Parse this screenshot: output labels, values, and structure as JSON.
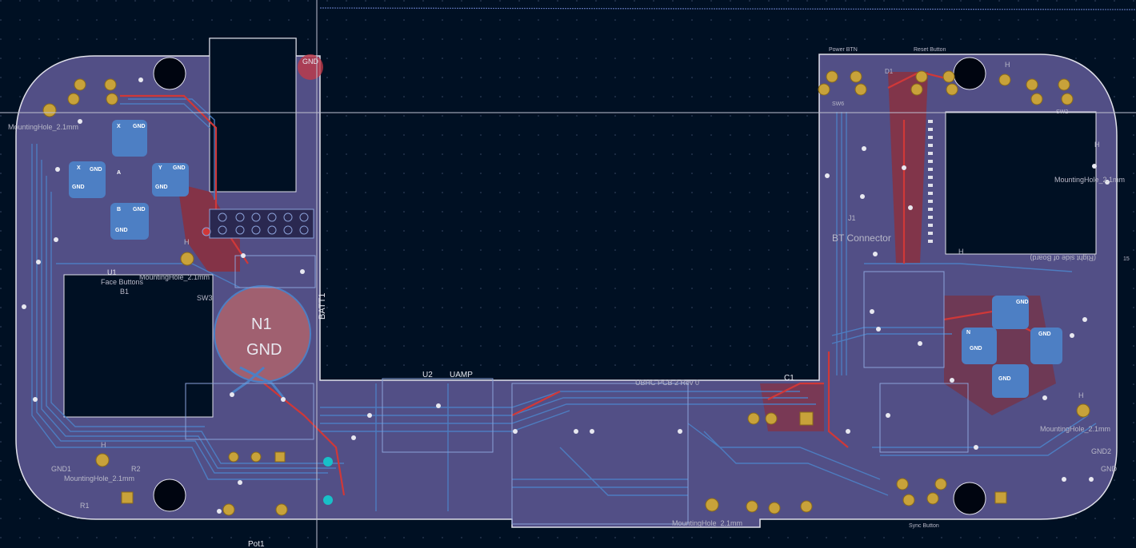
{
  "colors": {
    "background": "#001023",
    "board_fill": "#524f86",
    "board_edge": "#e0e0ea",
    "copper_front": "#c83232",
    "copper_back": "#4d7fc4",
    "pad_gold": "#c8a23a",
    "cursor": "#c0c0d0"
  },
  "labels": {
    "power_btn": "Power BTN",
    "reset_button": "Reset Button",
    "sync_button": "Sync Button",
    "gnd_pad": "GND",
    "n1": "N1",
    "n1_gnd": "GND",
    "batt1": "BATT1",
    "u1": "U1",
    "u2": "U2",
    "uamp": "UAMP",
    "c1": "C1",
    "pot1": "Pot1",
    "sw6": "SW6",
    "sw2": "SW2",
    "d1": "D1",
    "j1": "J1",
    "sw3": "SW3",
    "face_buttons": "Face Buttons",
    "b1": "B1",
    "bt_connector": "BT Connector",
    "mh_left": "MountingHole_2.1mm",
    "mh_right_top": "MountingHole_2.1mm",
    "mh_right_bottom": "MountingHole_2.1mm",
    "mh_bottom": "MountingHole_2.1mm",
    "mh_mid_left": "MountingHole_2.1mm",
    "mh_lower_left": "MountingHole_2.1mm",
    "gnd1": "GND1",
    "gnd2": "GND2",
    "gnd_right": "GND",
    "rev": "UBHC PCB 2 Rev 0",
    "r1": "R1",
    "r2": "R2",
    "h_mark": "H",
    "mirror_text": "(Right side of Board)",
    "number_15": "15"
  },
  "pad_texts": {
    "x": "X",
    "y": "Y",
    "a": "A",
    "b": "B",
    "n": "N",
    "gnd": "GND"
  }
}
